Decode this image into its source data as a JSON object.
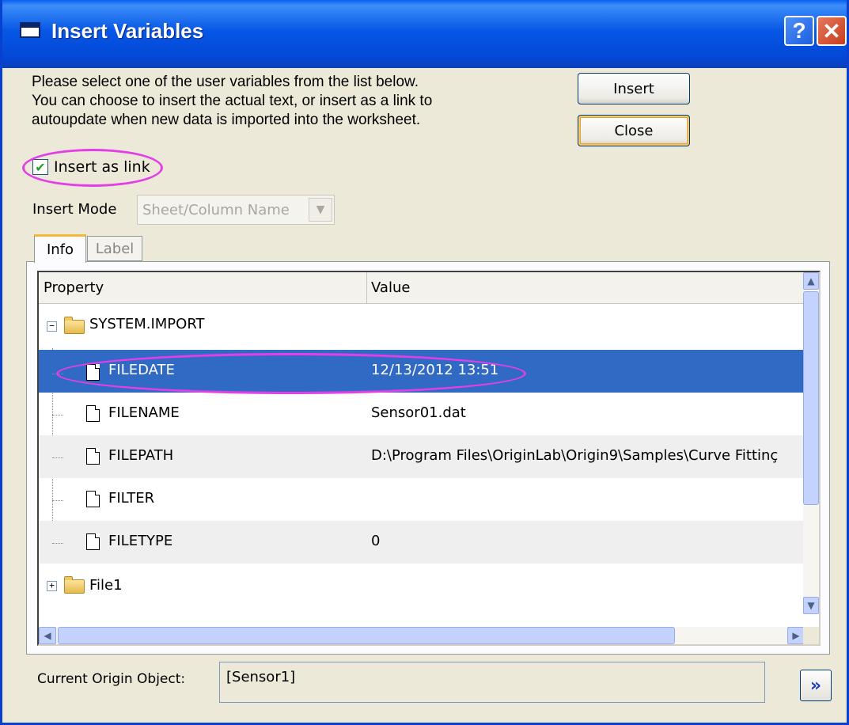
{
  "window": {
    "title": "Insert Variables",
    "help_glyph": "?",
    "close_glyph": "✕"
  },
  "intro_lines": [
    "Please select one of the user variables from the list below.",
    "You can choose to insert the actual text, or insert as a link to",
    "autoupdate when new data is imported into the worksheet."
  ],
  "buttons": {
    "insert": "Insert",
    "close": "Close",
    "more": "»"
  },
  "insert_as_link": {
    "label": "Insert as link",
    "checked": true
  },
  "insert_mode": {
    "label": "Insert Mode",
    "value": "Sheet/Column Name",
    "enabled": false
  },
  "tabs": [
    {
      "label": "Info",
      "active": true
    },
    {
      "label": "Label",
      "active": false
    }
  ],
  "grid": {
    "columns": [
      "Property",
      "Value"
    ],
    "rows": [
      {
        "name": "SYSTEM.IMPORT",
        "value": "",
        "kind": "folder",
        "expander": "−"
      },
      {
        "name": "FILEDATE",
        "value": "12/13/2012 13:51",
        "kind": "file",
        "selected": true
      },
      {
        "name": "FILENAME",
        "value": "Sensor01.dat",
        "kind": "file"
      },
      {
        "name": "FILEPATH",
        "value": "D:\\Program Files\\OriginLab\\Origin9\\Samples\\Curve Fittinç",
        "kind": "file"
      },
      {
        "name": "FILTER",
        "value": "",
        "kind": "file"
      },
      {
        "name": "FILETYPE",
        "value": "0",
        "kind": "file"
      },
      {
        "name": "File1",
        "value": "",
        "kind": "folder",
        "expander": "+"
      }
    ]
  },
  "current_origin_object": {
    "label": "Current Origin Object:",
    "value": "[Sensor1]"
  },
  "colors": {
    "title_bar": "#0757e6",
    "selection": "#316ac5",
    "annotation": "#e43ee6"
  }
}
